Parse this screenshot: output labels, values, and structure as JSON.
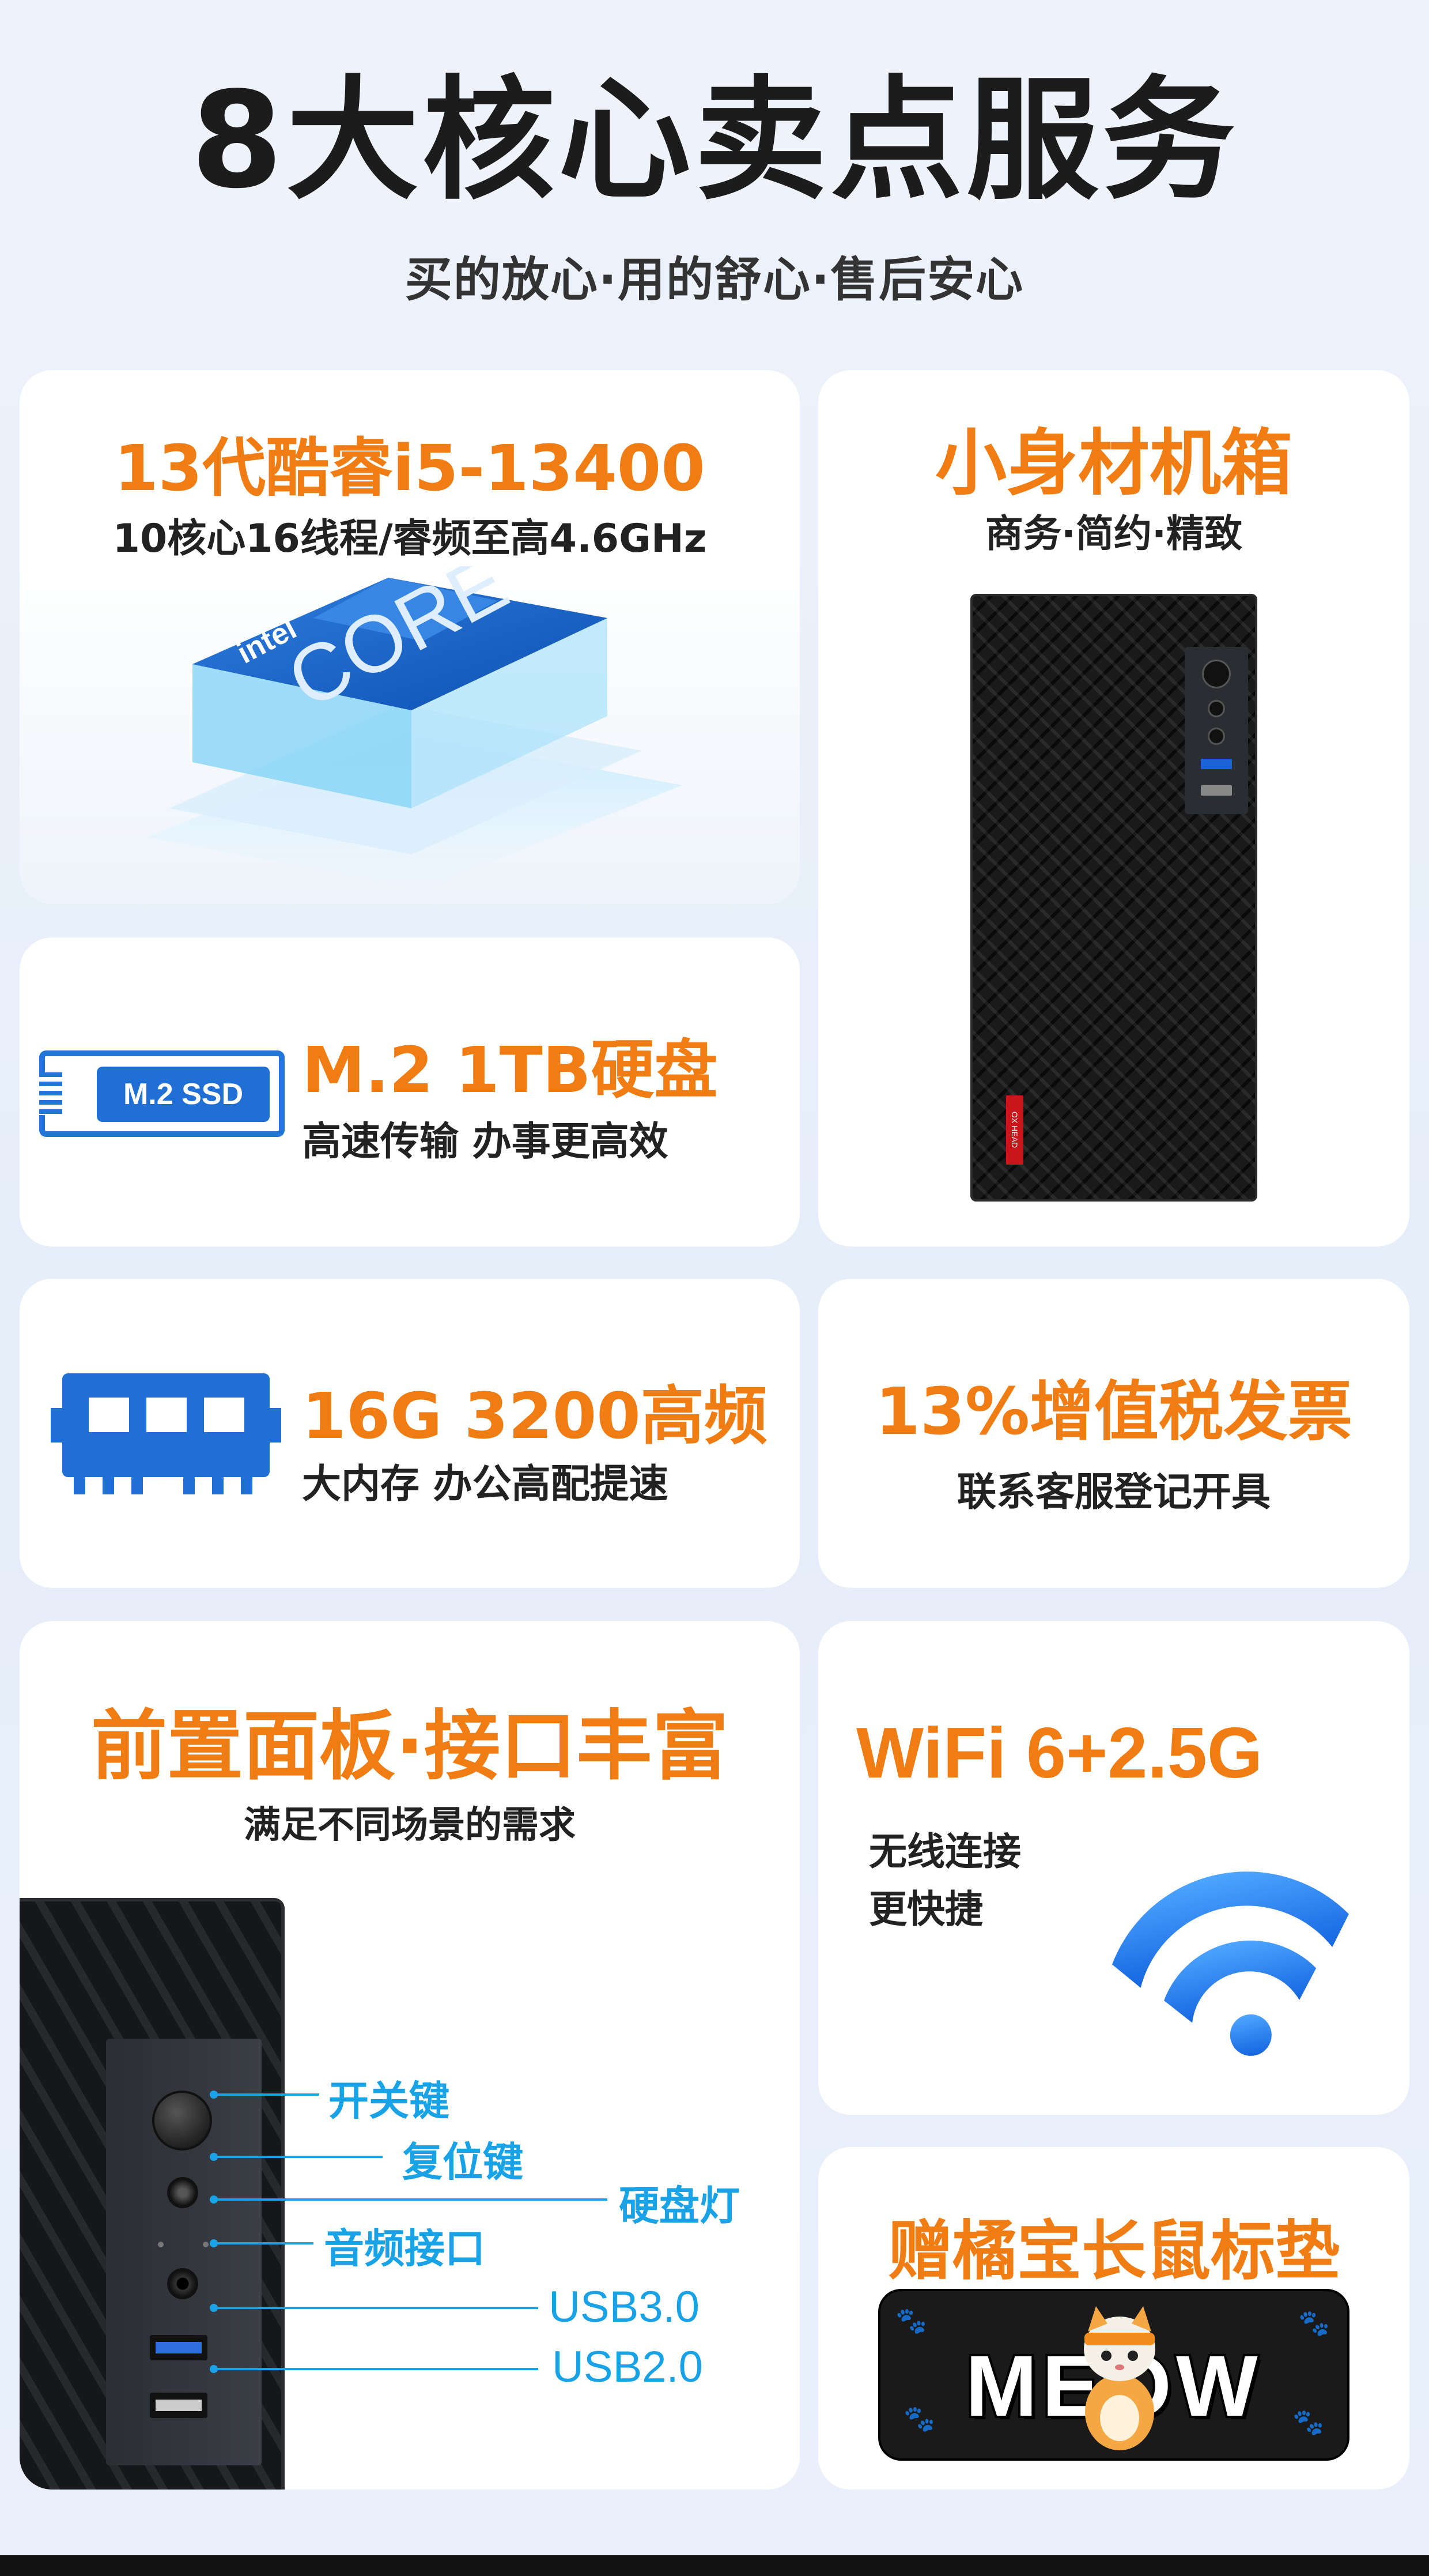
{
  "header": {
    "title": "8大核心卖点服务",
    "subtitle": "买的放心·用的舒心·售后安心"
  },
  "cpu": {
    "headline": "13代酷睿i5-13400",
    "detail": "10核心16线程/睿频至高4.6GHz",
    "chip_brand": "intel",
    "chip_name": "CORE"
  },
  "case": {
    "headline": "小身材机箱",
    "detail": "商务·简约·精致",
    "badge": "OX HEAD"
  },
  "ssd": {
    "headline": "M.2 1TB硬盘",
    "detail": "高速传输 办事更高效",
    "stick_label": "M.2 SSD"
  },
  "ram": {
    "headline": "16G 3200高频",
    "detail": "大内存 办公高配提速"
  },
  "vat": {
    "headline": "13%增值税发票",
    "detail": "联系客服登记开具"
  },
  "front": {
    "headline": "前置面板·接口丰富",
    "detail": "满足不同场景的需求",
    "callouts": [
      "开关键",
      "复位键",
      "硬盘灯",
      "音频接口",
      "USB3.0",
      "USB2.0"
    ]
  },
  "wifi": {
    "headline": "WiFi 6+2.5G",
    "line1": "无线连接",
    "line2": "更快捷"
  },
  "pad": {
    "headline": "赠橘宝长鼠标垫",
    "art_text": "MEOW"
  },
  "colors": {
    "accent": "#f07d14",
    "blue": "#1f6fd5",
    "callout": "#19a3e6"
  }
}
